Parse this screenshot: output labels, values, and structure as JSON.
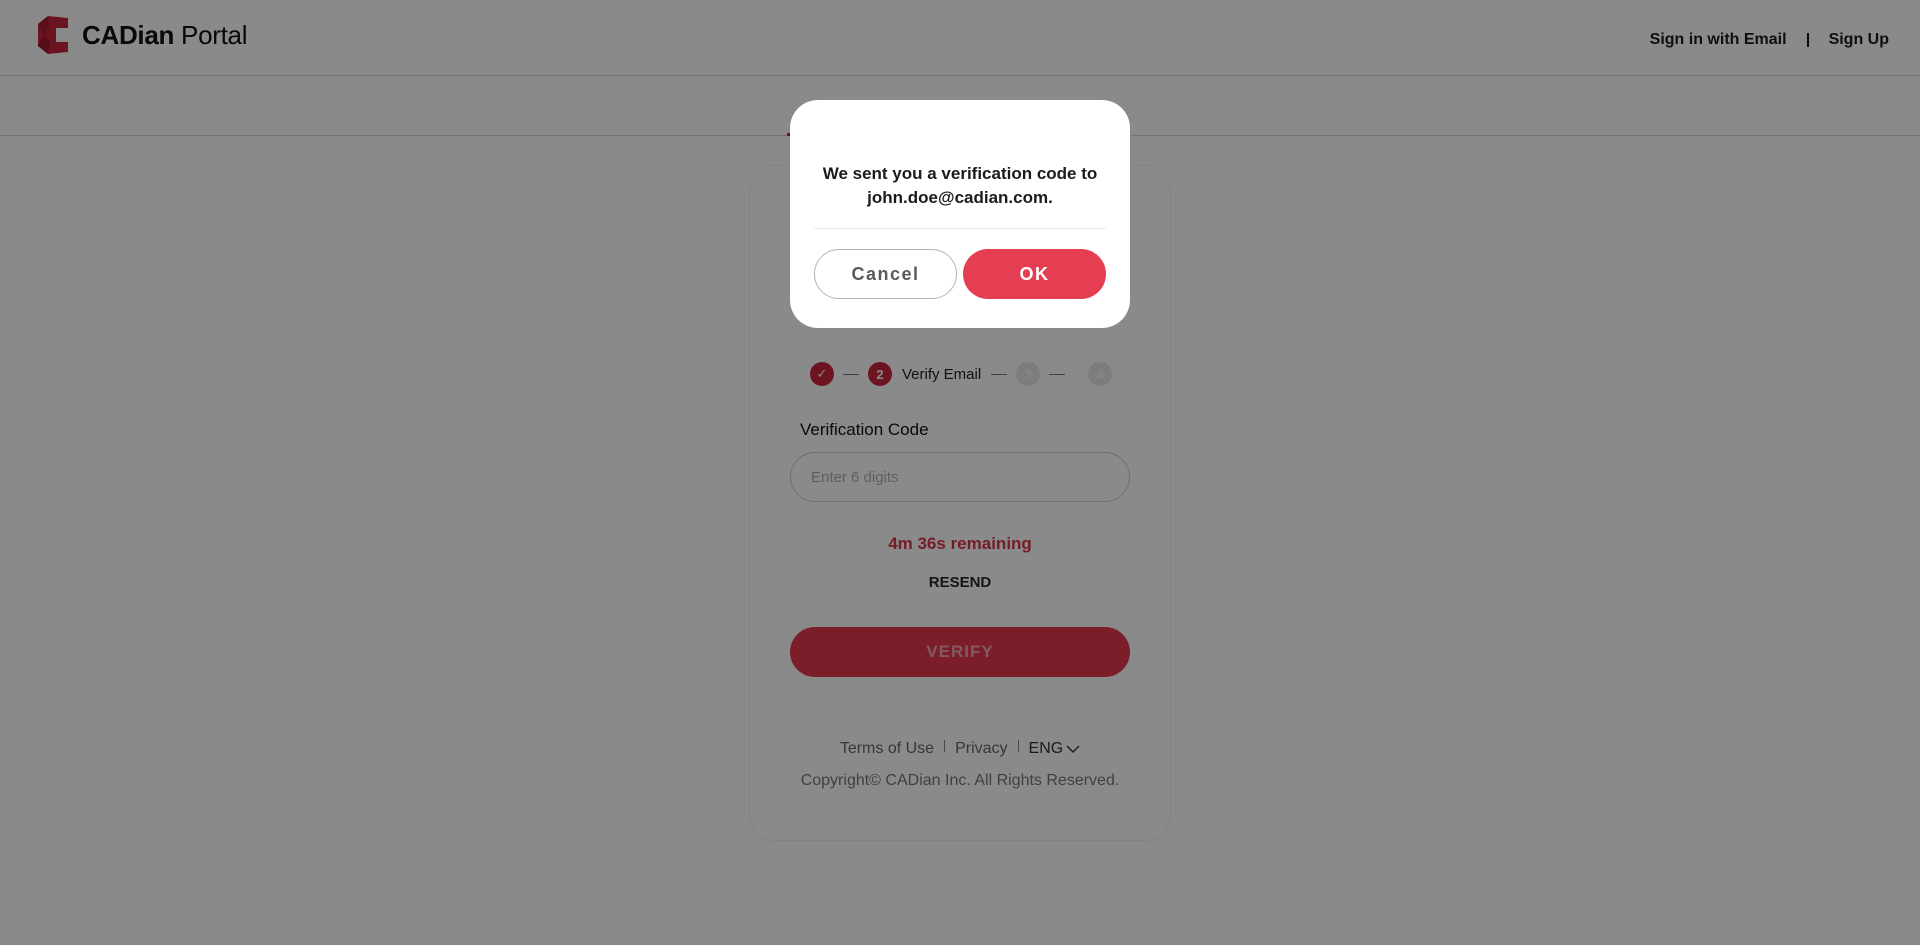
{
  "header": {
    "brand_bold": "CADian",
    "brand_light": "Portal",
    "logo_icon": "cadian-logo-icon",
    "nav": [
      {
        "label": "Sign in with Email"
      },
      {
        "label": "Sign Up"
      }
    ]
  },
  "card": {
    "stepper": {
      "steps": [
        {
          "state": "done",
          "marker": "✓",
          "label": ""
        },
        {
          "state": "active",
          "marker": "2",
          "label": "Verify Email"
        },
        {
          "state": "todo",
          "marker": "3",
          "label": ""
        },
        {
          "state": "todo",
          "marker": "4",
          "label": ""
        }
      ]
    },
    "verification_label": "Verification Code",
    "verification_placeholder": "Enter 6 digits",
    "verification_value": "",
    "timer_text": "4m 36s remaining",
    "resend_label": "RESEND",
    "verify_label": "VERIFY",
    "footer": {
      "terms": "Terms of Use",
      "privacy": "Privacy",
      "language": "ENG",
      "copyright": "Copyright© CADian Inc. All Rights Reserved."
    }
  },
  "modal": {
    "message_line1": "We sent you a verification code to",
    "message_line2": "john.doe@cadian.com.",
    "cancel_label": "Cancel",
    "ok_label": "OK"
  },
  "colors": {
    "brand_red": "#c8273c",
    "ok_button": "#e53d52",
    "timer_red": "#d8354a",
    "overlay": "rgba(0,0,0,0.46)"
  }
}
